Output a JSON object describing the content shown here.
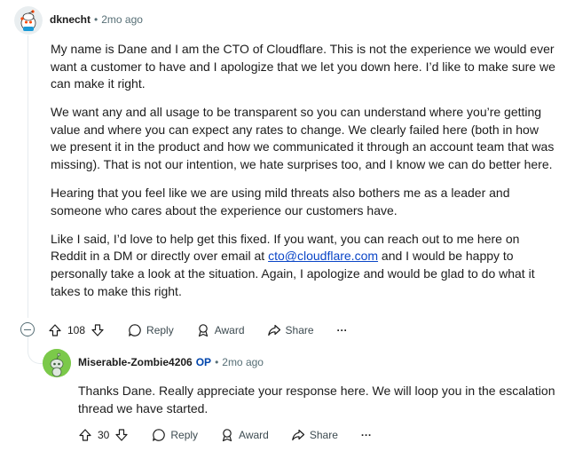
{
  "comment1": {
    "author": "dknecht",
    "separator": "•",
    "timestamp": "2mo ago",
    "paragraphs": [
      "My name is Dane and I am the CTO of Cloudflare. This is not the experience we would ever want a customer to have and I apologize that we let you down here. I’d like to make sure we can make it right.",
      "We want any and all usage to be transparent so you can understand where you’re getting value and where you can expect any rates to change. We clearly failed here (both in how we present it in the product and how we communicated it through an account team that was missing). That is not our intention, we hate surprises too, and I know we can do better here.",
      "Hearing that you feel like we are using mild threats also bothers me as a leader and someone who cares about the experience our customers have."
    ],
    "last_paragraph": {
      "before_link": "Like I said, I’d love to help get this fixed. If you want, you can reach out to me here on Reddit in a DM or directly over email at ",
      "link_text": "cto@cloudflare.com",
      "after_link": " and I would be happy to personally take a look at the situation. Again, I apologize and would be glad to do what it takes to make this right."
    },
    "actions": {
      "vote_count": "108",
      "reply_label": "Reply",
      "award_label": "Award",
      "share_label": "Share",
      "more_label": "···"
    }
  },
  "comment2": {
    "author": "Miserable-Zombie4206",
    "op_badge": "OP",
    "separator": "•",
    "timestamp": "2mo ago",
    "text": "Thanks Dane. Really appreciate your response here. We will loop you in the escalation thread we have started.",
    "actions": {
      "vote_count": "30",
      "reply_label": "Reply",
      "award_label": "Award",
      "share_label": "Share",
      "more_label": "···"
    }
  },
  "colors": {
    "text": "#1c1c1c",
    "meta": "#576f76",
    "link": "#0a45c7",
    "op": "#0045ac",
    "avatar2_bg": "#7bc94a"
  }
}
